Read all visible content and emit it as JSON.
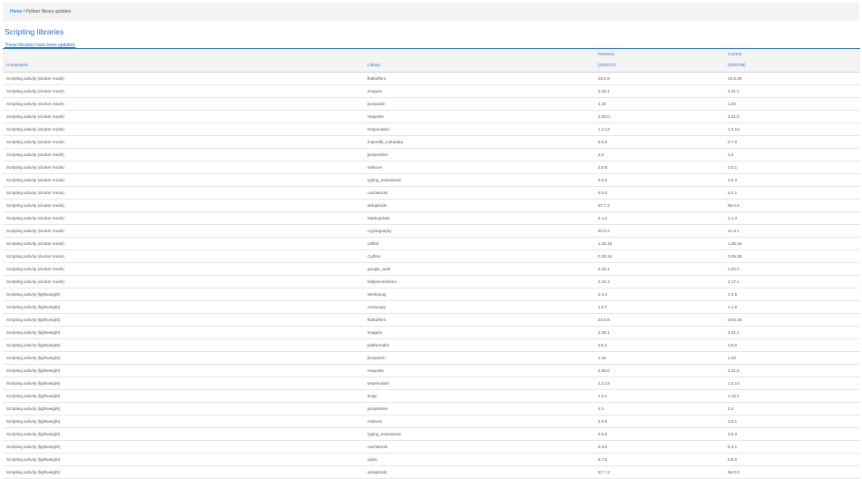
{
  "breadcrumb": {
    "home": "Home",
    "separator": "/",
    "current": "Python library updates"
  },
  "page": {
    "title": "Scripting libraries",
    "description": "These libraries have been updated."
  },
  "table": {
    "columns": {
      "component": "Component",
      "library": "Library",
      "previous": "Previous",
      "previous_date": "(2023.07)",
      "current": "Current",
      "current_date": "(2023.08)"
    },
    "rows": [
      {
        "component": "Scripting activity (cluster mode)",
        "library": "flatbuffers",
        "previous": "23.5.9",
        "current": "23.5.26"
      },
      {
        "component": "Scripting activity (cluster mode)",
        "library": "imageio",
        "previous": "2.28.1",
        "current": "2.31.1"
      },
      {
        "component": "Scripting activity (cluster mode)",
        "library": "jsonpatch",
        "previous": "1.32",
        "current": "1.33"
      },
      {
        "component": "Scripting activity (cluster mode)",
        "library": "requests",
        "previous": "2.30.0",
        "current": "2.31.0"
      },
      {
        "component": "Scripting activity (cluster mode)",
        "library": "Deprecated",
        "previous": "1.2.13",
        "current": "1.2.14"
      },
      {
        "component": "Scripting activity (cluster mode)",
        "library": "importlib_metadata",
        "previous": "6.6.0",
        "current": "6.7.0"
      },
      {
        "component": "Scripting activity (cluster mode)",
        "library": "jsonpointer",
        "previous": "2.3",
        "current": "2.4"
      },
      {
        "component": "Scripting activity (cluster mode)",
        "library": "mistune",
        "previous": "2.0.5",
        "current": "3.0.1"
      },
      {
        "component": "Scripting activity (cluster mode)",
        "library": "typing_extensions",
        "previous": "4.5.0",
        "current": "4.6.3"
      },
      {
        "component": "Scripting activity (cluster mode)",
        "library": "cachetools",
        "previous": "5.3.0",
        "current": "5.3.1"
      },
      {
        "component": "Scripting activity (cluster mode)",
        "library": "setuptools",
        "previous": "67.7.2",
        "current": "68.0.0"
      },
      {
        "component": "Scripting activity (cluster mode)",
        "library": "MarkupSafe",
        "previous": "2.1.2",
        "current": "2.1.3"
      },
      {
        "component": "Scripting activity (cluster mode)",
        "library": "cryptography",
        "previous": "40.0.2",
        "current": "41.0.1"
      },
      {
        "component": "Scripting activity (cluster mode)",
        "library": "urllib3",
        "previous": "1.26.15",
        "current": "1.26.16"
      },
      {
        "component": "Scripting activity (cluster mode)",
        "library": "Cython",
        "previous": "0.29.34",
        "current": "0.29.35"
      },
      {
        "component": "Scripting activity (cluster mode)",
        "library": "google_auth",
        "previous": "2.18.1",
        "current": "2.20.0"
      },
      {
        "component": "Scripting activity (cluster mode)",
        "library": "fastjsonschema",
        "previous": "2.16.3",
        "current": "2.17.1"
      },
      {
        "component": "Scripting activity (lightweight)",
        "library": "Werkzeug",
        "previous": "2.3.4",
        "current": "2.3.6"
      },
      {
        "component": "Scripting activity (lightweight)",
        "library": "contourpy",
        "previous": "1.0.7",
        "current": "1.1.0"
      },
      {
        "component": "Scripting activity (lightweight)",
        "library": "flatbuffers",
        "previous": "23.5.9",
        "current": "23.5.26"
      },
      {
        "component": "Scripting activity (lightweight)",
        "library": "imageio",
        "previous": "2.28.1",
        "current": "2.31.1"
      },
      {
        "component": "Scripting activity (lightweight)",
        "library": "platformdirs",
        "previous": "3.5.1",
        "current": "3.8.0"
      },
      {
        "component": "Scripting activity (lightweight)",
        "library": "jsonpatch",
        "previous": "1.32",
        "current": "1.33"
      },
      {
        "component": "Scripting activity (lightweight)",
        "library": "requests",
        "previous": "2.30.0",
        "current": "2.31.0"
      },
      {
        "component": "Scripting activity (lightweight)",
        "library": "Deprecated",
        "previous": "1.2.13",
        "current": "1.2.14"
      },
      {
        "component": "Scripting activity (lightweight)",
        "library": "scipy",
        "previous": "1.9.1",
        "current": "1.10.1"
      },
      {
        "component": "Scripting activity (lightweight)",
        "library": "jsonpointer",
        "previous": "2.3",
        "current": "2.4"
      },
      {
        "component": "Scripting activity (lightweight)",
        "library": "mistune",
        "previous": "2.0.5",
        "current": "3.0.1"
      },
      {
        "component": "Scripting activity (lightweight)",
        "library": "typing_extensions",
        "previous": "4.5.0",
        "current": "4.6.3"
      },
      {
        "component": "Scripting activity (lightweight)",
        "library": "cachetools",
        "previous": "5.3.0",
        "current": "5.3.1"
      },
      {
        "component": "Scripting activity (lightweight)",
        "library": "ujson",
        "previous": "5.7.0",
        "current": "5.8.0"
      },
      {
        "component": "Scripting activity (lightweight)",
        "library": "setuptools",
        "previous": "67.7.2",
        "current": "68.0.0"
      }
    ]
  }
}
